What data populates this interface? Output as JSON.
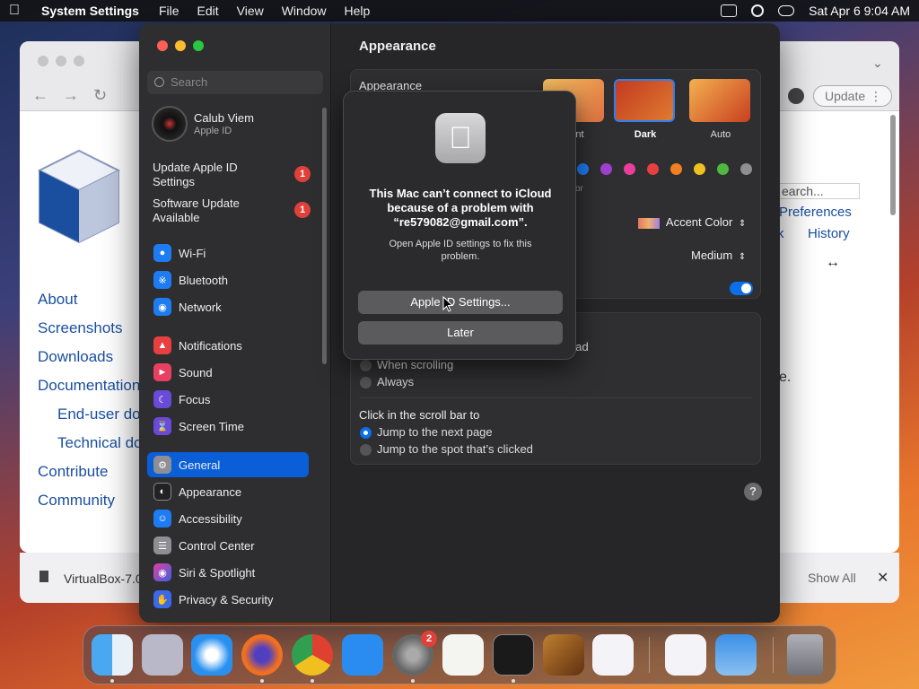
{
  "menubar": {
    "app_name": "System Settings",
    "menus": [
      "File",
      "Edit",
      "View",
      "Window",
      "Help"
    ],
    "datetime": "Sat Apr 6  9:04 AM"
  },
  "browser": {
    "update_label": "Update",
    "search_placeholder": "earch...",
    "nav_links": [
      "About",
      "Screenshots",
      "Downloads",
      "Documentation",
      "End-user docs",
      "Technical docs",
      "Contribute",
      "Community"
    ],
    "right_links": [
      "Preferences",
      "k",
      "History"
    ],
    "page_fragment": "e.",
    "download_name": "VirtualBox-7.0",
    "show_all": "Show All"
  },
  "settings": {
    "search_placeholder": "Search",
    "profile": {
      "name": "Calub Viem",
      "subtitle": "Apple ID"
    },
    "alerts": [
      {
        "label": "Update Apple ID Settings",
        "badge": "1"
      },
      {
        "label": "Software Update Available",
        "badge": "1"
      }
    ],
    "sidebar_items": [
      {
        "label": "Wi-Fi",
        "color": "#1e7cf2"
      },
      {
        "label": "Bluetooth",
        "color": "#1e7cf2"
      },
      {
        "label": "Network",
        "color": "#1e7cf2"
      },
      {
        "label": "Notifications",
        "color": "#e84040"
      },
      {
        "label": "Sound",
        "color": "#e84060"
      },
      {
        "label": "Focus",
        "color": "#6a4ad8"
      },
      {
        "label": "Screen Time",
        "color": "#6a4ad8"
      },
      {
        "label": "General",
        "color": "#8e8e93"
      },
      {
        "label": "Appearance",
        "color": "#222222"
      },
      {
        "label": "Accessibility",
        "color": "#1e7cf2"
      },
      {
        "label": "Control Center",
        "color": "#8e8e93"
      },
      {
        "label": "Siri & Spotlight",
        "color": "#a040d0"
      },
      {
        "label": "Privacy & Security",
        "color": "#3a6ae8"
      }
    ],
    "selected": "General",
    "content": {
      "title": "Appearance",
      "appearance_label": "Appearance",
      "themes": [
        {
          "label": "Light",
          "visible": "nt"
        },
        {
          "label": "Dark",
          "visible": "Dark"
        },
        {
          "label": "Auto",
          "visible": "Auto"
        }
      ],
      "accent_colors": [
        "#1e7cf2",
        "#a040d0",
        "#e8409a",
        "#e84040",
        "#f08020",
        "#f0c020",
        "#50b840",
        "#8e8e93"
      ],
      "accent_fragment": "or",
      "highlight_color": "Accent Color",
      "sidebar_icon_size": "Medium",
      "scrollbar_fragment": "ckpad",
      "scroll_options": [
        "When scrolling",
        "Always"
      ],
      "click_label": "Click in the scroll bar to",
      "click_options": [
        "Jump to the next page",
        "Jump to the spot that’s clicked"
      ],
      "help": "?"
    }
  },
  "dialog": {
    "title": "This Mac can’t connect to iCloud because of a problem with “re579082@gmail.com”.",
    "message": "Open Apple ID settings to fix this problem.",
    "primary_button": "Apple ID Settings...",
    "secondary_button": "Later"
  },
  "dock": {
    "settings_badge": "2"
  }
}
